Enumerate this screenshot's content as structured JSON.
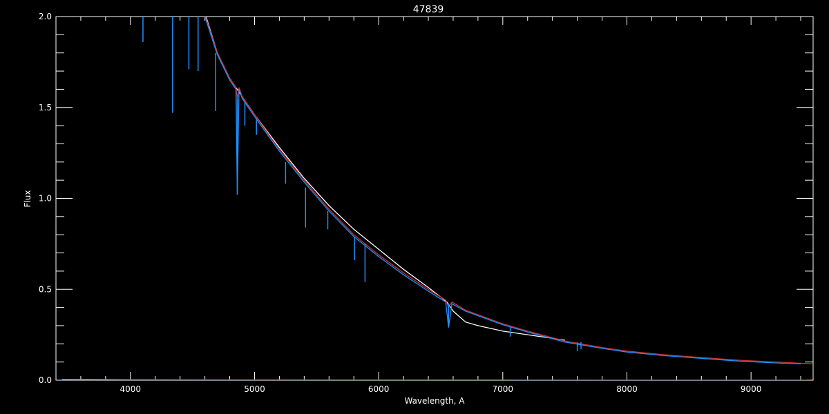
{
  "chart_data": {
    "type": "line",
    "title": "47839",
    "xlabel": "Wavelength, A",
    "ylabel": "Flux",
    "xlim": [
      3400,
      9500
    ],
    "ylim": [
      0.0,
      2.0
    ],
    "grid": false,
    "legend": "none",
    "x_ticks": [
      4000,
      5000,
      6000,
      7000,
      8000,
      9000
    ],
    "x_tick_labels": [
      "4000",
      "5000",
      "6000",
      "7000",
      "8000",
      "9000"
    ],
    "y_ticks": [
      0.0,
      0.5,
      1.0,
      1.5,
      2.0
    ],
    "y_tick_labels": [
      "0.0",
      "0.5",
      "1.0",
      "1.5",
      "2.0"
    ],
    "colors": {
      "background": "#000000",
      "axes": "#ffffff",
      "observed": "#ffffff",
      "model_red": "#d03030",
      "model_blue": "#1e90ff"
    },
    "series": [
      {
        "color": "#ffffff",
        "x": [
          4600,
          4700,
          4800,
          4900,
          5000,
          5200,
          5400,
          5600,
          5800,
          6000,
          6200,
          6400,
          6550,
          6600,
          6700,
          6800,
          7000,
          7200,
          7500
        ],
        "y": [
          2.02,
          1.8,
          1.66,
          1.56,
          1.46,
          1.28,
          1.11,
          0.96,
          0.83,
          0.72,
          0.61,
          0.51,
          0.43,
          0.38,
          0.32,
          0.3,
          0.27,
          0.25,
          0.22
        ]
      },
      {
        "color": "#d03030",
        "x": [
          4600,
          4700,
          4800,
          4850,
          4861,
          4875,
          4900,
          5000,
          5200,
          5400,
          5600,
          5800,
          6000,
          6200,
          6400,
          6540,
          6563,
          6590,
          6700,
          6800,
          7000,
          7200,
          7500,
          7800,
          8000,
          8300,
          8600,
          8900,
          9200,
          9500
        ],
        "y": [
          2.01,
          1.8,
          1.66,
          1.61,
          1.55,
          1.61,
          1.56,
          1.46,
          1.27,
          1.1,
          0.94,
          0.8,
          0.69,
          0.59,
          0.5,
          0.44,
          0.4,
          0.43,
          0.385,
          0.36,
          0.31,
          0.27,
          0.215,
          0.18,
          0.16,
          0.14,
          0.125,
          0.11,
          0.1,
          0.09
        ]
      },
      {
        "color": "#1e90ff",
        "x": [
          4600,
          4700,
          4800,
          4850,
          4861,
          4875,
          4900,
          5000,
          5200,
          5400,
          5600,
          5800,
          6000,
          6200,
          6400,
          6540,
          6563,
          6590,
          6700,
          6800,
          7000,
          7200,
          7500,
          7800,
          8000,
          8300,
          8600,
          8900,
          9200,
          9400
        ],
        "y": [
          2.0,
          1.79,
          1.65,
          1.6,
          1.02,
          1.6,
          1.55,
          1.45,
          1.26,
          1.09,
          0.93,
          0.79,
          0.68,
          0.58,
          0.49,
          0.43,
          0.29,
          0.42,
          0.38,
          0.355,
          0.305,
          0.265,
          0.21,
          0.175,
          0.155,
          0.135,
          0.12,
          0.105,
          0.095,
          0.09
        ]
      },
      {
        "color": "#1e90ff",
        "x": [
          3450,
          4000,
          5000,
          6000,
          7000,
          8000,
          9000,
          9450
        ],
        "y": [
          0.005,
          0.003,
          0.002,
          0.001,
          0.001,
          0.0005,
          0.0005,
          0.0005
        ]
      }
    ],
    "absorption_lines": [
      {
        "x": 4101,
        "y0": 2.0,
        "y1": 1.86
      },
      {
        "x": 4340,
        "y0": 2.0,
        "y1": 1.47
      },
      {
        "x": 4471,
        "y0": 2.0,
        "y1": 1.71
      },
      {
        "x": 4545,
        "y0": 2.0,
        "y1": 1.7
      },
      {
        "x": 4686,
        "y0": 1.8,
        "y1": 1.48
      },
      {
        "x": 4861,
        "y0": 1.55,
        "y1": 1.02
      },
      {
        "x": 4922,
        "y0": 1.53,
        "y1": 1.4
      },
      {
        "x": 5015,
        "y0": 1.44,
        "y1": 1.35
      },
      {
        "x": 5250,
        "y0": 1.2,
        "y1": 1.08
      },
      {
        "x": 5411,
        "y0": 1.06,
        "y1": 0.84
      },
      {
        "x": 5590,
        "y0": 0.93,
        "y1": 0.83
      },
      {
        "x": 5805,
        "y0": 0.79,
        "y1": 0.66
      },
      {
        "x": 5890,
        "y0": 0.75,
        "y1": 0.54
      },
      {
        "x": 6563,
        "y0": 0.42,
        "y1": 0.29
      },
      {
        "x": 7060,
        "y0": 0.29,
        "y1": 0.24
      },
      {
        "x": 7600,
        "y0": 0.21,
        "y1": 0.16
      },
      {
        "x": 7630,
        "y0": 0.21,
        "y1": 0.17
      }
    ]
  }
}
